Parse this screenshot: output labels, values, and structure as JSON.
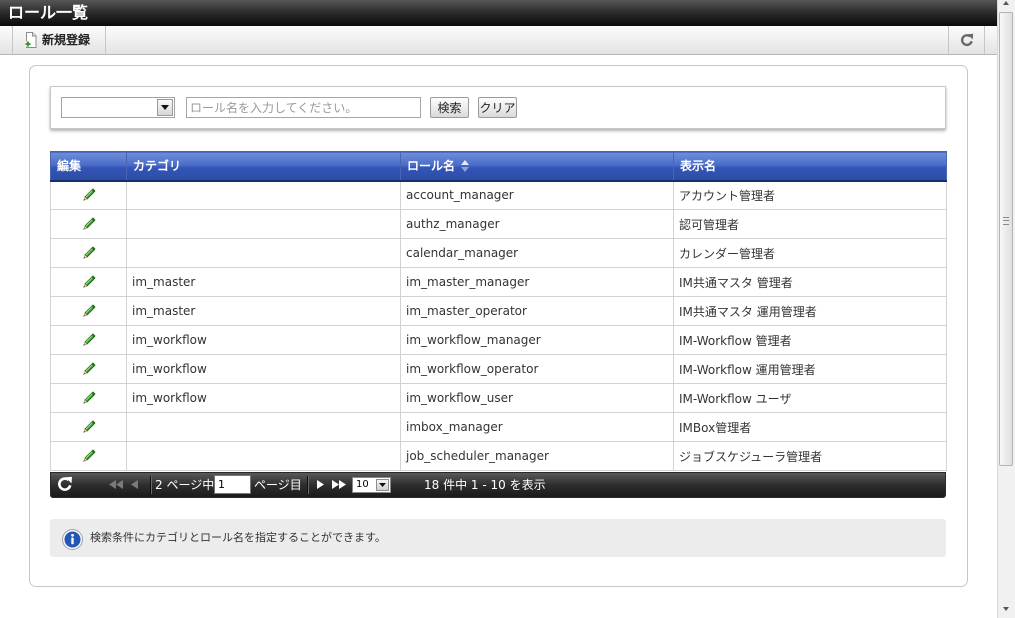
{
  "window": {
    "title": "ロール一覧"
  },
  "toolbar": {
    "new_label": "新規登録",
    "new_icon": "new-document-icon",
    "refresh_icon": "refresh-icon"
  },
  "search": {
    "category_select": {
      "selected": ""
    },
    "keyword": {
      "value": "",
      "placeholder": "ロール名を入力してください。"
    },
    "search_label": "検索",
    "clear_label": "クリア"
  },
  "table": {
    "columns": [
      {
        "label": "編集"
      },
      {
        "label": "カテゴリ"
      },
      {
        "label": "ロール名",
        "sort_icon": "sort-ascending-icon"
      },
      {
        "label": "表示名"
      }
    ],
    "edit_icon": "pencil-icon",
    "rows": [
      {
        "category": "",
        "role_name": "account_manager",
        "display_name": "アカウント管理者"
      },
      {
        "category": "",
        "role_name": "authz_manager",
        "display_name": "認可管理者"
      },
      {
        "category": "",
        "role_name": "calendar_manager",
        "display_name": "カレンダー管理者"
      },
      {
        "category": "im_master",
        "role_name": "im_master_manager",
        "display_name": "IM共通マスタ 管理者"
      },
      {
        "category": "im_master",
        "role_name": "im_master_operator",
        "display_name": "IM共通マスタ 運用管理者"
      },
      {
        "category": "im_workflow",
        "role_name": "im_workflow_manager",
        "display_name": "IM-Workflow 管理者"
      },
      {
        "category": "im_workflow",
        "role_name": "im_workflow_operator",
        "display_name": "IM-Workflow 運用管理者"
      },
      {
        "category": "im_workflow",
        "role_name": "im_workflow_user",
        "display_name": "IM-Workflow ユーザ"
      },
      {
        "category": "",
        "role_name": "imbox_manager",
        "display_name": "IMBox管理者"
      },
      {
        "category": "",
        "role_name": "job_scheduler_manager",
        "display_name": "ジョブスケジューラ管理者"
      }
    ]
  },
  "pager": {
    "refresh_icon": "refresh-icon",
    "nav_icons": {
      "first": "first-page-icon",
      "prev": "previous-page-icon",
      "next": "next-page-icon",
      "last": "last-page-icon"
    },
    "total_pages_label": "2 ページ中",
    "current_page": "1",
    "page_suffix": "ページ目",
    "page_size": "10",
    "summary": "18 件中 1 - 10 を表示"
  },
  "info": {
    "icon": "info-icon",
    "message": "検索条件にカテゴリとロール名を指定することができます。"
  },
  "colors": {
    "title_bar": "#1a1a1a",
    "table_header": "#3355b5",
    "pager_bar": "#2e2e2e",
    "edit_icon": "#3fa531",
    "info_icon": "#2357b3"
  }
}
